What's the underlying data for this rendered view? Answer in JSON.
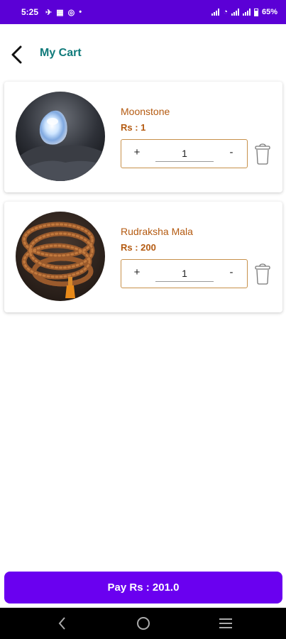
{
  "status_bar": {
    "time": "5:25",
    "battery": "65%",
    "icons": [
      "vpn-icon",
      "qr-icon",
      "hotspot-icon",
      "wifi-icon",
      "signal-icon",
      "battery-icon"
    ]
  },
  "header": {
    "title": "My Cart",
    "back_icon": "arrow-back-icon"
  },
  "cart": {
    "items": [
      {
        "name": "Moonstone",
        "price": "Rs : 1",
        "quantity": "1",
        "plus": "+",
        "minus": "-"
      },
      {
        "name": "Rudraksha Mala",
        "price": "Rs : 200",
        "quantity": "1",
        "plus": "+",
        "minus": "-"
      }
    ]
  },
  "footer": {
    "pay_label": "Pay Rs : 201.0"
  },
  "colors": {
    "status_bar": "#5b00d6",
    "accent_title": "#0f7a7a",
    "price_text": "#b45a10",
    "pay_button": "#6a00f0",
    "qty_border": "#c7904a"
  },
  "nav": {
    "icons": [
      "nav-back-icon",
      "nav-home-icon",
      "nav-menu-icon"
    ]
  }
}
